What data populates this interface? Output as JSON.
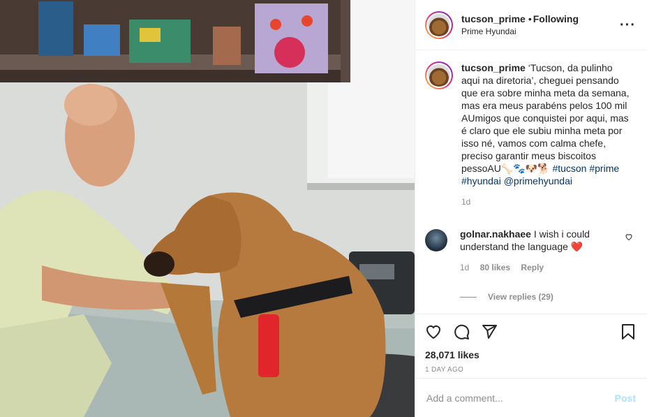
{
  "post": {
    "username": "tucson_prime",
    "follow_label": "Following",
    "location": "Prime Hyundai",
    "caption_user": "tucson_prime",
    "caption_text": "‘Tucson, da pulinho aqui na diretoria’, cheguei pensando que era sobre minha meta da semana, mas era meus parabéns pelos 100 mil AUmigos que conquistei por aqui, mas é claro que ele subiu minha meta por isso né, vamos com calma chefe, preciso garantir meus biscoitos pessoAU🦴🐾🐶🐕",
    "hashtags": "#tucson #prime #hyundai",
    "mention": "@primehyundai",
    "caption_age": "1d",
    "likes": "28,071 likes",
    "posted": "1 DAY AGO"
  },
  "comment": {
    "username": "golnar.nakhaee",
    "text": "I wish i could understand the language ❤️",
    "age": "1d",
    "likes": "80 likes",
    "reply": "Reply",
    "view_replies": "View replies (29)"
  },
  "composer": {
    "placeholder": "Add a comment...",
    "post_label": "Post"
  },
  "icons": {
    "more": "more-options-icon",
    "like": "heart-icon",
    "comment": "comment-icon",
    "share": "share-icon",
    "save": "bookmark-icon"
  }
}
